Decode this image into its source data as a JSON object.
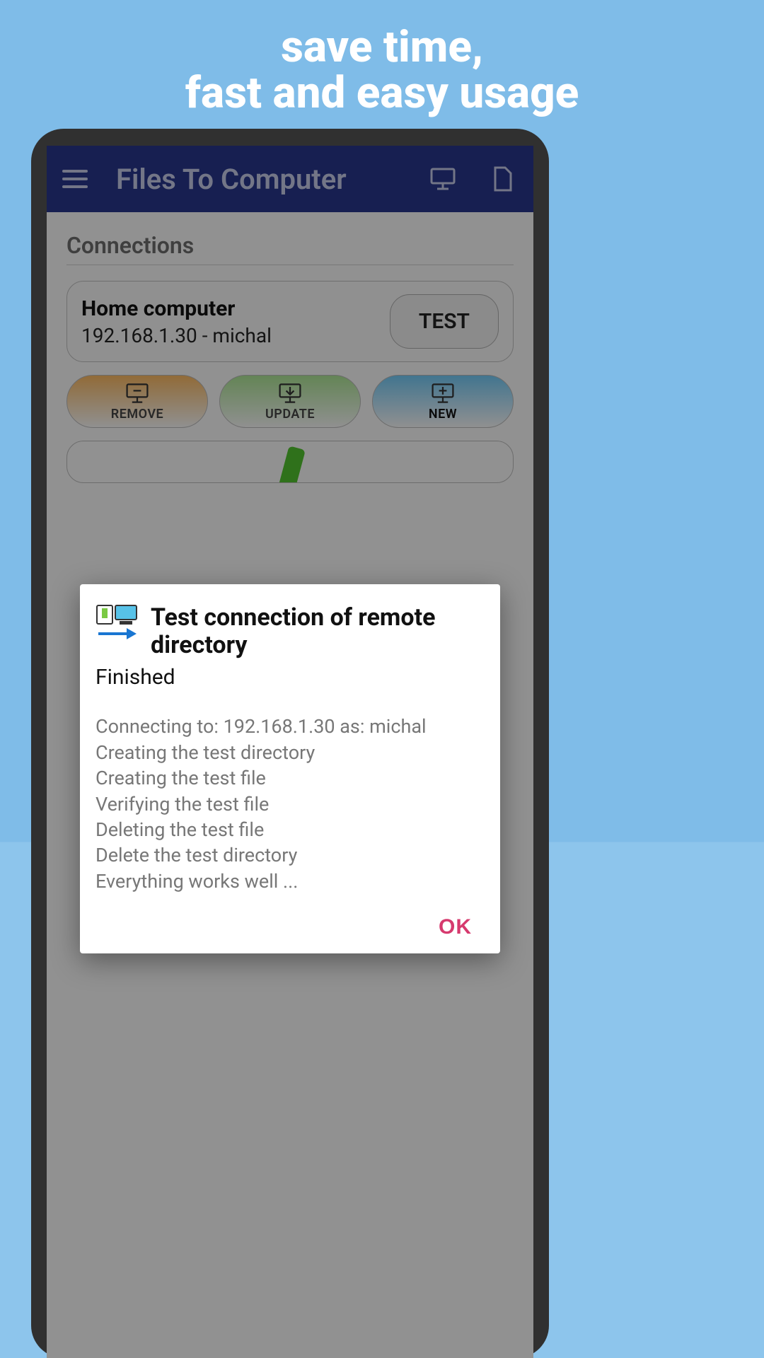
{
  "promo": {
    "line1": "save time,",
    "line2": "fast and easy usage"
  },
  "app_bar": {
    "title": "Files To Computer"
  },
  "connections": {
    "section_label": "Connections",
    "items": [
      {
        "name": "Home computer",
        "address": "192.168.1.30 - michal",
        "test_label": "TEST"
      }
    ]
  },
  "actions": {
    "remove": "REMOVE",
    "update": "UPDATE",
    "new": "NEW"
  },
  "dialog": {
    "title": "Test connection of remote directory",
    "status": "Finished",
    "body": "Connecting to: 192.168.1.30 as: michal\nCreating the test directory\nCreating the test file\nVerifying the test file\nDeleting the test file\nDelete the test directory\nEverything works well ...",
    "ok": "OK"
  }
}
